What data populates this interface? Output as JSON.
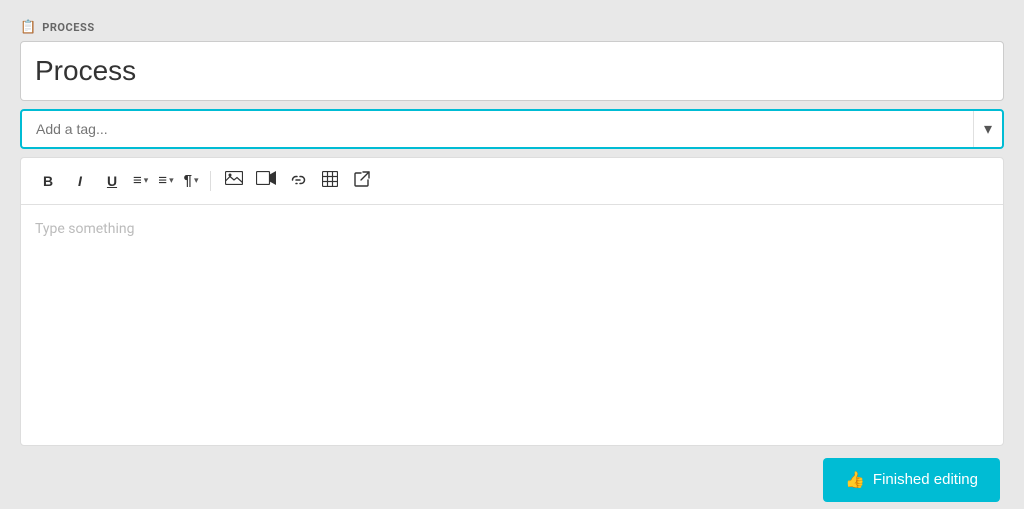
{
  "header": {
    "icon": "📋",
    "label": "PROCESS"
  },
  "title_input": {
    "value": "Process",
    "placeholder": "Process"
  },
  "tag_input": {
    "placeholder": "Add a tag..."
  },
  "toolbar": {
    "bold_label": "B",
    "italic_label": "I",
    "underline_label": "U",
    "ordered_list_label": "≡",
    "unordered_list_label": "☰",
    "paragraph_label": "¶",
    "image_label": "🖼",
    "video_label": "▶",
    "link_label": "🔗",
    "table_label": "⊞",
    "external_label": "⧉",
    "dropdown_arrow": "▾"
  },
  "editor": {
    "placeholder": "Type something"
  },
  "footer": {
    "finished_button": "Finished editing",
    "thumb_icon": "👍"
  }
}
